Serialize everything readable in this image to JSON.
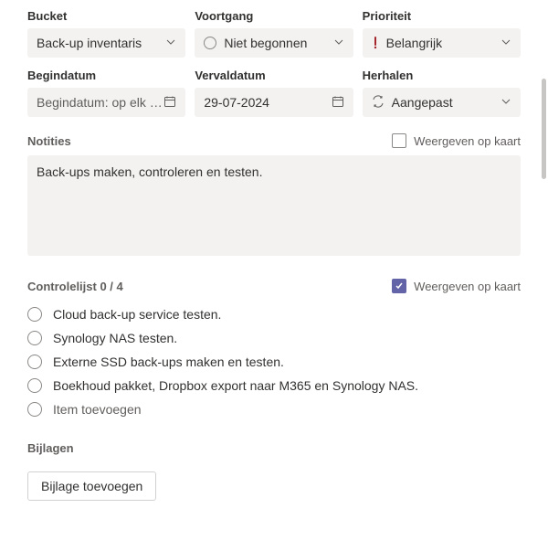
{
  "fields": {
    "bucket": {
      "label": "Bucket",
      "value": "Back-up inventaris"
    },
    "progress": {
      "label": "Voortgang",
      "value": "Niet begonnen"
    },
    "priority": {
      "label": "Prioriteit",
      "value": "Belangrijk"
    },
    "startDate": {
      "label": "Begindatum",
      "placeholder": "Begindatum: op elk ge..."
    },
    "dueDate": {
      "label": "Vervaldatum",
      "value": "29-07-2024"
    },
    "repeat": {
      "label": "Herhalen",
      "value": "Aangepast"
    }
  },
  "notes": {
    "label": "Notities",
    "showOnCard": "Weergeven op kaart",
    "value": "Back-ups maken, controleren en testen."
  },
  "checklist": {
    "label": "Controlelijst",
    "count": "0 / 4",
    "showOnCard": "Weergeven op kaart",
    "items": [
      "Cloud back-up service testen.",
      "Synology NAS testen.",
      "Externe SSD back-ups maken en testen.",
      "Boekhoud pakket, Dropbox export naar M365 en Synology NAS."
    ],
    "addItem": "Item toevoegen"
  },
  "attachments": {
    "label": "Bijlagen",
    "addButton": "Bijlage toevoegen"
  }
}
